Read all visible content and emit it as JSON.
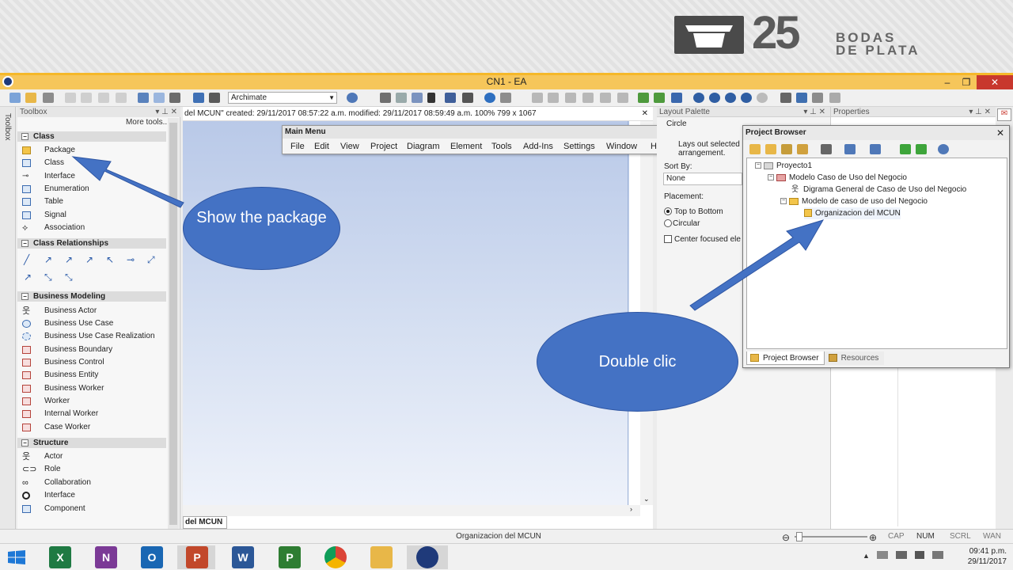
{
  "banner": {
    "logo_number": "25",
    "logo_line1": "BODAS",
    "logo_line2": "DE PLATA"
  },
  "window": {
    "title": "CN1 - EA",
    "min_icon": "minimize-icon",
    "max_icon": "maximize-icon",
    "close_icon": "close-icon",
    "min_glyph": "–",
    "max_glyph": "❐",
    "close_glyph": "✕"
  },
  "toolbar": {
    "perspective": "Archimate"
  },
  "toolbox": {
    "title": "Toolbox",
    "side_label": "Toolbox",
    "more_tools": "More tools...",
    "categories": [
      {
        "name": "Class",
        "items": [
          "Package",
          "Class",
          "Interface",
          "Enumeration",
          "Table",
          "Signal",
          "Association"
        ]
      },
      {
        "name": "Class Relationships",
        "items": []
      },
      {
        "name": "Business Modeling",
        "items": [
          "Business Actor",
          "Business Use Case",
          "Business Use Case Realization",
          "Business Boundary",
          "Business Control",
          "Business Entity",
          "Business Worker",
          "Worker",
          "Internal Worker",
          "Case Worker"
        ]
      },
      {
        "name": "Structure",
        "items": [
          "Actor",
          "Role",
          "Collaboration",
          "Interface",
          "Component"
        ]
      }
    ]
  },
  "diagram": {
    "info": "del MCUN\"  created: 29/11/2017 08:57:22 a.m.  modified: 29/11/2017 08:59:49 a.m.   100%   799 x 1067",
    "tab": "del MCUN"
  },
  "main_menu": {
    "title": "Main Menu",
    "items": [
      "File",
      "Edit",
      "View",
      "Project",
      "Diagram",
      "Element",
      "Tools",
      "Add-Ins",
      "Settings",
      "Window",
      "Help"
    ]
  },
  "layout_palette": {
    "title": "Layout Palette",
    "option": "Circle",
    "description": "Lays out selected arrangement.",
    "sort_by_label": "Sort By:",
    "sort_by_value": "None",
    "placement_label": "Placement:",
    "placement_opt1": "Top to Bottom",
    "placement_opt2": "Circular",
    "center_focused": "Center focused ele"
  },
  "properties": {
    "title": "Properties"
  },
  "project_browser": {
    "title": "Project Browser",
    "tree": [
      {
        "label": "Proyecto1",
        "level": 0
      },
      {
        "label": "Modelo Caso de Uso del Negocio",
        "level": 1
      },
      {
        "label": "Digrama General de Caso de Uso del Negocio",
        "level": 2
      },
      {
        "label": "Modelo de caso de uso del Negocio",
        "level": 2
      },
      {
        "label": "Organizacion del MCUN",
        "level": 3
      }
    ],
    "tabs": [
      "Project Browser",
      "Resources"
    ]
  },
  "annotations": {
    "show_package": "Show the package",
    "double_click": "Double clic"
  },
  "statusbar": {
    "center": "Organizacion del MCUN",
    "indicators": [
      "CAP",
      "NUM",
      "SCRL",
      "WAN"
    ]
  },
  "taskbar": {
    "time": "09:41 p.m.",
    "date": "29/11/2017"
  },
  "colors": {
    "accent": "#f6c65a",
    "bubble": "#4472c4",
    "close": "#c8372d"
  }
}
